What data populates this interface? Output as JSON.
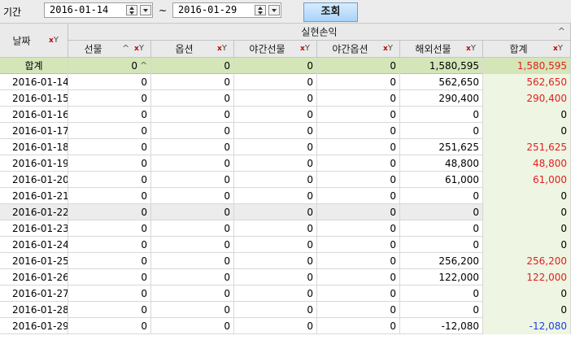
{
  "toolbar": {
    "period_label": "기간",
    "date_from": "2016-01-14",
    "date_to": "2016-01-29",
    "tilde": "~",
    "query_button": "조회"
  },
  "grid": {
    "group_header": "실현손익",
    "columns": {
      "date": "날짜",
      "futures": "선물",
      "options": "옵션",
      "night_futures": "야간선물",
      "night_options": "야간옵션",
      "overseas_futures": "해외선물",
      "total": "합계"
    },
    "total_row": {
      "label": "합계",
      "futures": "0",
      "options": "0",
      "night_futures": "0",
      "night_options": "0",
      "overseas_futures": "1,580,595",
      "total": "1,580,595"
    },
    "rows": [
      {
        "date": "2016-01-14",
        "futures": "0",
        "options": "0",
        "night_futures": "0",
        "night_options": "0",
        "overseas_futures": "562,650",
        "total": "562,650",
        "tone": "red"
      },
      {
        "date": "2016-01-15",
        "futures": "0",
        "options": "0",
        "night_futures": "0",
        "night_options": "0",
        "overseas_futures": "290,400",
        "total": "290,400",
        "tone": "red"
      },
      {
        "date": "2016-01-16",
        "futures": "0",
        "options": "0",
        "night_futures": "0",
        "night_options": "0",
        "overseas_futures": "0",
        "total": "0",
        "tone": "none"
      },
      {
        "date": "2016-01-17",
        "futures": "0",
        "options": "0",
        "night_futures": "0",
        "night_options": "0",
        "overseas_futures": "0",
        "total": "0",
        "tone": "none"
      },
      {
        "date": "2016-01-18",
        "futures": "0",
        "options": "0",
        "night_futures": "0",
        "night_options": "0",
        "overseas_futures": "251,625",
        "total": "251,625",
        "tone": "red"
      },
      {
        "date": "2016-01-19",
        "futures": "0",
        "options": "0",
        "night_futures": "0",
        "night_options": "0",
        "overseas_futures": "48,800",
        "total": "48,800",
        "tone": "red"
      },
      {
        "date": "2016-01-20",
        "futures": "0",
        "options": "0",
        "night_futures": "0",
        "night_options": "0",
        "overseas_futures": "61,000",
        "total": "61,000",
        "tone": "red"
      },
      {
        "date": "2016-01-21",
        "futures": "0",
        "options": "0",
        "night_futures": "0",
        "night_options": "0",
        "overseas_futures": "0",
        "total": "0",
        "tone": "none"
      },
      {
        "date": "2016-01-22",
        "futures": "0",
        "options": "0",
        "night_futures": "0",
        "night_options": "0",
        "overseas_futures": "0",
        "total": "0",
        "tone": "none",
        "selected": true
      },
      {
        "date": "2016-01-23",
        "futures": "0",
        "options": "0",
        "night_futures": "0",
        "night_options": "0",
        "overseas_futures": "0",
        "total": "0",
        "tone": "none"
      },
      {
        "date": "2016-01-24",
        "futures": "0",
        "options": "0",
        "night_futures": "0",
        "night_options": "0",
        "overseas_futures": "0",
        "total": "0",
        "tone": "none"
      },
      {
        "date": "2016-01-25",
        "futures": "0",
        "options": "0",
        "night_futures": "0",
        "night_options": "0",
        "overseas_futures": "256,200",
        "total": "256,200",
        "tone": "red"
      },
      {
        "date": "2016-01-26",
        "futures": "0",
        "options": "0",
        "night_futures": "0",
        "night_options": "0",
        "overseas_futures": "122,000",
        "total": "122,000",
        "tone": "red"
      },
      {
        "date": "2016-01-27",
        "futures": "0",
        "options": "0",
        "night_futures": "0",
        "night_options": "0",
        "overseas_futures": "0",
        "total": "0",
        "tone": "none"
      },
      {
        "date": "2016-01-28",
        "futures": "0",
        "options": "0",
        "night_futures": "0",
        "night_options": "0",
        "overseas_futures": "0",
        "total": "0",
        "tone": "none"
      },
      {
        "date": "2016-01-29",
        "futures": "0",
        "options": "0",
        "night_futures": "0",
        "night_options": "0",
        "overseas_futures": "-12,080",
        "total": "-12,080",
        "tone": "blue"
      }
    ]
  },
  "colors": {
    "total_row_bg": "#d4e6b8",
    "sum_column_bg": "#eef5e2",
    "profit": "#e02020",
    "loss": "#1a3fe0",
    "query_button": "#a9d3f8"
  },
  "icons": {
    "spin": "spin-updown-icon",
    "dropdown": "chevron-down-icon",
    "filter": "filter-icon",
    "sort": "sort-caret-up-icon"
  }
}
